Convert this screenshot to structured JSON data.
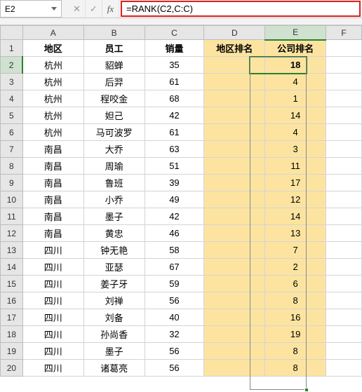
{
  "formula_bar": {
    "name_box": "E2",
    "cancel_icon": "✕",
    "enter_icon": "✓",
    "fx_icon": "fx",
    "formula": "=RANK(C2,C:C)"
  },
  "columns": [
    "A",
    "B",
    "C",
    "D",
    "E",
    "F"
  ],
  "row_numbers": [
    1,
    2,
    3,
    4,
    5,
    6,
    7,
    8,
    9,
    10,
    11,
    12,
    13,
    14,
    15,
    16,
    17,
    18,
    19,
    20
  ],
  "header_row": {
    "a": "地区",
    "b": "员工",
    "c": "销量",
    "d": "地区排名",
    "e": "公司排名"
  },
  "rows": [
    {
      "a": "杭州",
      "b": "貂蝉",
      "c": "35",
      "d": "",
      "e": "18"
    },
    {
      "a": "杭州",
      "b": "后羿",
      "c": "61",
      "d": "",
      "e": "4"
    },
    {
      "a": "杭州",
      "b": "程咬金",
      "c": "68",
      "d": "",
      "e": "1"
    },
    {
      "a": "杭州",
      "b": "妲己",
      "c": "42",
      "d": "",
      "e": "14"
    },
    {
      "a": "杭州",
      "b": "马可波罗",
      "c": "61",
      "d": "",
      "e": "4"
    },
    {
      "a": "南昌",
      "b": "大乔",
      "c": "63",
      "d": "",
      "e": "3"
    },
    {
      "a": "南昌",
      "b": "周瑜",
      "c": "51",
      "d": "",
      "e": "11"
    },
    {
      "a": "南昌",
      "b": "鲁班",
      "c": "39",
      "d": "",
      "e": "17"
    },
    {
      "a": "南昌",
      "b": "小乔",
      "c": "49",
      "d": "",
      "e": "12"
    },
    {
      "a": "南昌",
      "b": "墨子",
      "c": "42",
      "d": "",
      "e": "14"
    },
    {
      "a": "南昌",
      "b": "黄忠",
      "c": "46",
      "d": "",
      "e": "13"
    },
    {
      "a": "四川",
      "b": "钟无艳",
      "c": "58",
      "d": "",
      "e": "7"
    },
    {
      "a": "四川",
      "b": "亚瑟",
      "c": "67",
      "d": "",
      "e": "2"
    },
    {
      "a": "四川",
      "b": "姜子牙",
      "c": "59",
      "d": "",
      "e": "6"
    },
    {
      "a": "四川",
      "b": "刘禅",
      "c": "56",
      "d": "",
      "e": "8"
    },
    {
      "a": "四川",
      "b": "刘备",
      "c": "40",
      "d": "",
      "e": "16"
    },
    {
      "a": "四川",
      "b": "孙尚香",
      "c": "32",
      "d": "",
      "e": "19"
    },
    {
      "a": "四川",
      "b": "墨子",
      "c": "56",
      "d": "",
      "e": "8"
    },
    {
      "a": "四川",
      "b": "诸葛亮",
      "c": "56",
      "d": "",
      "e": "8"
    }
  ],
  "chart_data": {
    "type": "table",
    "title": "",
    "columns": [
      "地区",
      "员工",
      "销量",
      "地区排名",
      "公司排名"
    ],
    "data": [
      [
        "杭州",
        "貂蝉",
        35,
        null,
        18
      ],
      [
        "杭州",
        "后羿",
        61,
        null,
        4
      ],
      [
        "杭州",
        "程咬金",
        68,
        null,
        1
      ],
      [
        "杭州",
        "妲己",
        42,
        null,
        14
      ],
      [
        "杭州",
        "马可波罗",
        61,
        null,
        4
      ],
      [
        "南昌",
        "大乔",
        63,
        null,
        3
      ],
      [
        "南昌",
        "周瑜",
        51,
        null,
        11
      ],
      [
        "南昌",
        "鲁班",
        39,
        null,
        17
      ],
      [
        "南昌",
        "小乔",
        49,
        null,
        12
      ],
      [
        "南昌",
        "墨子",
        42,
        null,
        14
      ],
      [
        "南昌",
        "黄忠",
        46,
        null,
        13
      ],
      [
        "四川",
        "钟无艳",
        58,
        null,
        7
      ],
      [
        "四川",
        "亚瑟",
        67,
        null,
        2
      ],
      [
        "四川",
        "姜子牙",
        59,
        null,
        6
      ],
      [
        "四川",
        "刘禅",
        56,
        null,
        8
      ],
      [
        "四川",
        "刘备",
        40,
        null,
        16
      ],
      [
        "四川",
        "孙尚香",
        32,
        null,
        19
      ],
      [
        "四川",
        "墨子",
        56,
        null,
        8
      ],
      [
        "四川",
        "诸葛亮",
        56,
        null,
        8
      ]
    ]
  }
}
